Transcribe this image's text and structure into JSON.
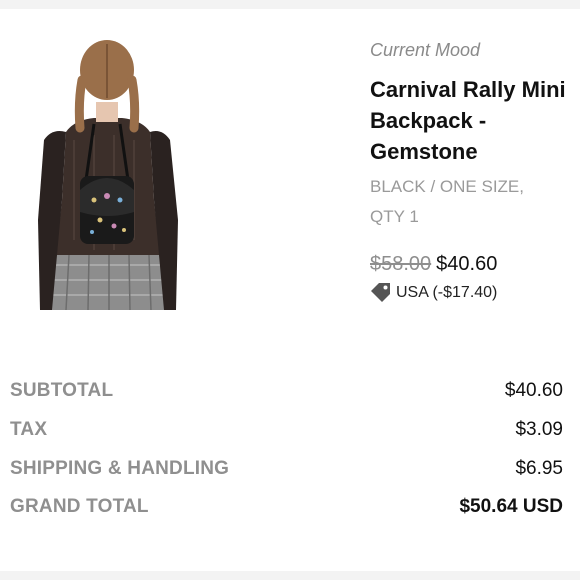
{
  "product": {
    "brand": "Current Mood",
    "title": "Carnival Rally Mini Backpack - Gemstone",
    "variant": "BLACK / ONE SIZE,",
    "quantity": "QTY 1",
    "original_price": "$58.00",
    "sale_price": "$40.60",
    "discount_label": "USA (-$17.40)",
    "discount_icon": "price-tag-icon",
    "image": "model-wearing-mini-backpack"
  },
  "summary": [
    {
      "label": "SUBTOTAL",
      "value": "$40.60"
    },
    {
      "label": "TAX",
      "value": "$3.09"
    },
    {
      "label": "SHIPPING & HANDLING",
      "value": "$6.95"
    },
    {
      "label": "GRAND TOTAL",
      "value": "$50.64 USD"
    }
  ],
  "colors": {
    "label_gray": "#8f8f8f",
    "brand_gray": "#8a8a8a",
    "text": "#111111"
  }
}
